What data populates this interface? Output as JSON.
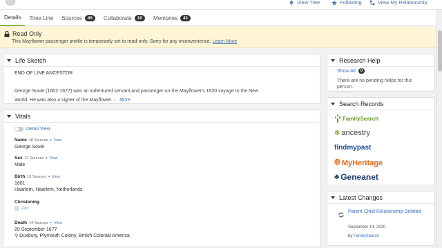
{
  "actions": {
    "view_tree": "View Tree",
    "following": "Following",
    "view_relationship": "View My Relationship"
  },
  "tabs": [
    {
      "label": "Details",
      "count": null
    },
    {
      "label": "Time Line",
      "count": null
    },
    {
      "label": "Sources",
      "count": "45"
    },
    {
      "label": "Collaborate",
      "count": "10"
    },
    {
      "label": "Memories",
      "count": "41"
    }
  ],
  "notice": {
    "title": "Read Only",
    "message": "This Mayflower passenger profile is temporarily set to read-only. Sorry for any inconvenience.",
    "link": "Learn More"
  },
  "life_sketch": {
    "title": "Life Sketch",
    "heading": "END OF LINE ANCESTOR",
    "line1": "George Soule (1602-1677) was an indentured servant and passenger on the Mayflower's 1620 voyage to the New",
    "line2": "World. He was also a signer of the Mayflower ...",
    "more": "More"
  },
  "vitals": {
    "title": "Vitals",
    "detail_view": "Detail View",
    "view": "View",
    "items": {
      "name": {
        "label": "Name",
        "sources": "38 Sources",
        "value1": "George Soule"
      },
      "sex": {
        "label": "Sex",
        "sources": "37 Sources",
        "value1": "Male"
      },
      "birth": {
        "label": "Birth",
        "sources": "13 Sources",
        "value1": "1601",
        "value2": "Haarlem, Haarlem, Netherlands"
      },
      "christening": {
        "label": "Christening",
        "add": "Add"
      },
      "death": {
        "label": "Death",
        "sources": "14 Sources",
        "value1": "20 September 1677",
        "value2": "Duxbury, Plymouth Colony, British Colonial America"
      }
    }
  },
  "research_help": {
    "title": "Research Help",
    "show_all": "Show All",
    "count": "0",
    "none": "There are no pending helps for this person."
  },
  "search_records": {
    "title": "Search Records",
    "logos": {
      "familysearch": "FamilySearch",
      "ancestry": "ancestry",
      "findmypast": "findmypast",
      "myheritage": "MyHeritage",
      "geneanet": "Geneanet"
    }
  },
  "latest_changes": {
    "title": "Latest Changes",
    "item": "Parent-Child Relationship Deleted",
    "date": "September 14, 2020",
    "by_prefix": "by",
    "by_name": "FamilySearch"
  },
  "colors": {
    "accent_green": "#8cb63c",
    "link_blue": "#3b6fb6",
    "notice_bg": "#fdf5d5"
  }
}
